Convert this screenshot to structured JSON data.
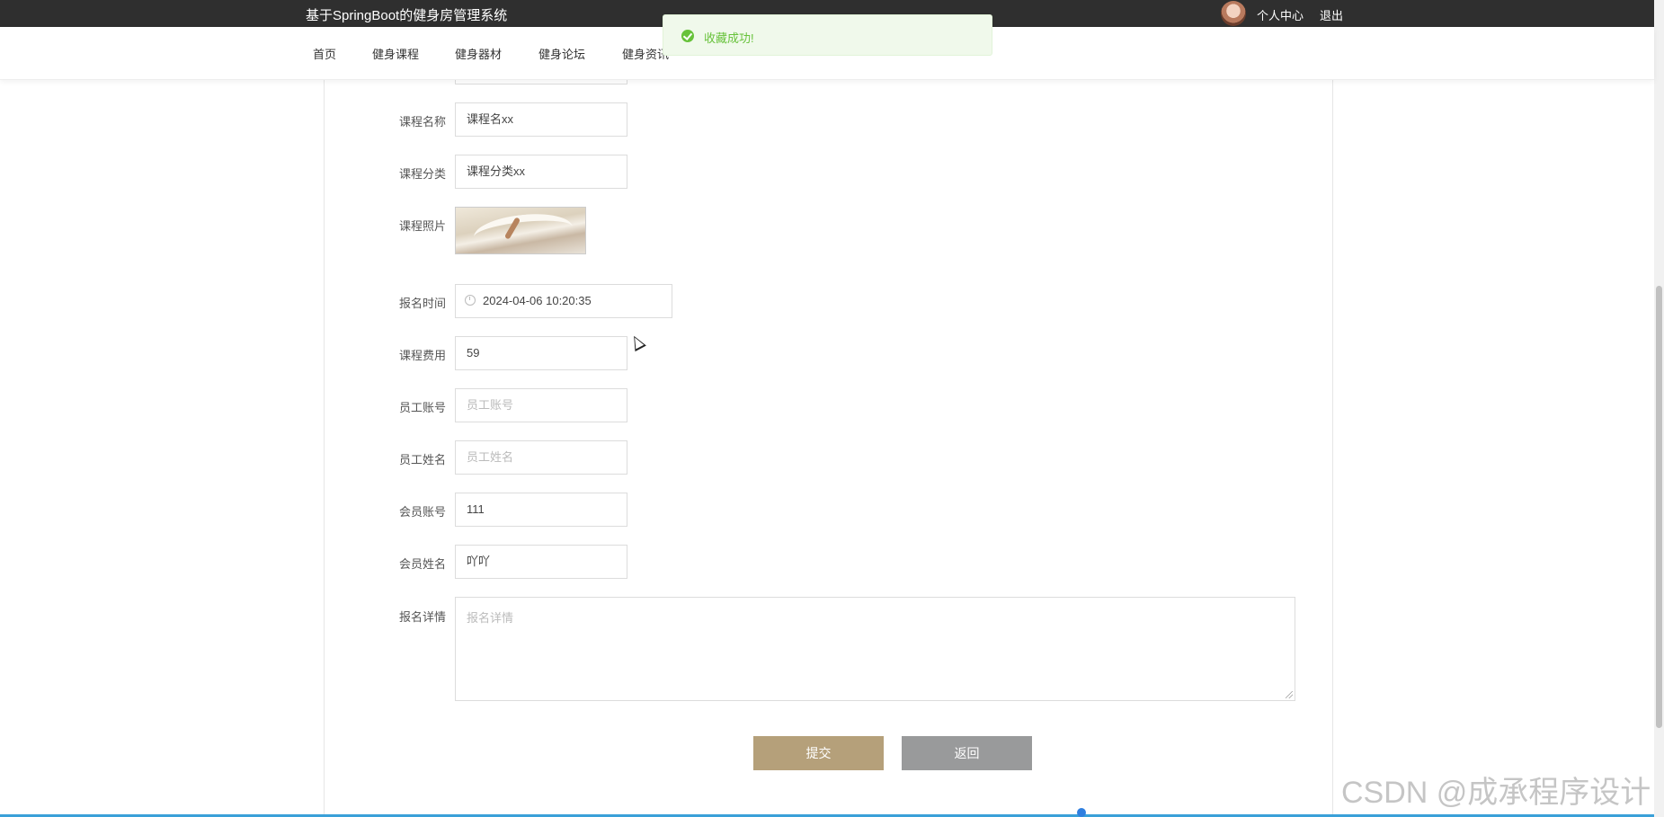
{
  "header": {
    "site_title": "基于SpringBoot的健身房管理系统",
    "user_center": "个人中心",
    "logout": "退出"
  },
  "nav": {
    "items": [
      "首页",
      "健身课程",
      "健身器材",
      "健身论坛",
      "健身资讯"
    ]
  },
  "toast": {
    "message": "收藏成功!"
  },
  "form": {
    "course_name": {
      "label": "课程名称",
      "value": "课程名xx"
    },
    "course_category": {
      "label": "课程分类",
      "value": "课程分类xx"
    },
    "course_photo": {
      "label": "课程照片"
    },
    "signup_time": {
      "label": "报名时间",
      "value": "2024-04-06 10:20:35"
    },
    "course_fee": {
      "label": "课程费用",
      "value": "59"
    },
    "staff_account": {
      "label": "员工账号",
      "placeholder": "员工账号"
    },
    "staff_name": {
      "label": "员工姓名",
      "placeholder": "员工姓名"
    },
    "member_account": {
      "label": "会员账号",
      "value": "111"
    },
    "member_name": {
      "label": "会员姓名",
      "value": "吖吖"
    },
    "signup_details": {
      "label": "报名详情",
      "placeholder": "报名详情"
    }
  },
  "buttons": {
    "submit": "提交",
    "back": "返回"
  },
  "watermark": "CSDN @成承程序设计",
  "colors": {
    "topbar": "#2f2f2f",
    "submit_button": "#b5a07a",
    "back_button": "#999a9b",
    "toast_bg": "#f0f9eb",
    "toast_text": "#67c23a"
  }
}
